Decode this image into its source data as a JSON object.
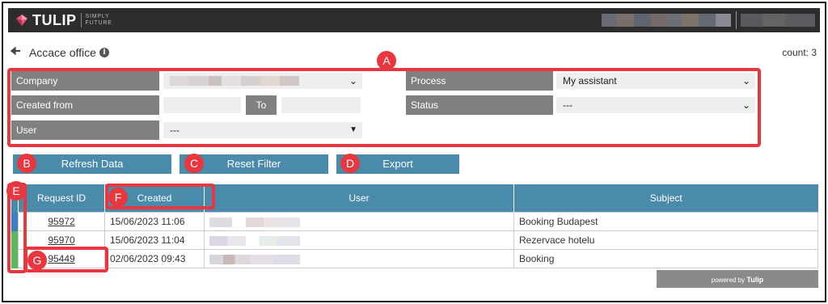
{
  "brand": {
    "name": "TULIP",
    "tagline_1": "SIMPLY",
    "tagline_2": "FUTURE"
  },
  "page": {
    "title": "Accace office",
    "count_text": "count: 3"
  },
  "filters": {
    "company_label": "Company",
    "created_from_label": "Created from",
    "to_label": "To",
    "user_label": "User",
    "user_value": "---",
    "process_label": "Process",
    "process_value": "My assistant",
    "status_label": "Status",
    "status_value": "---"
  },
  "buttons": {
    "refresh": "Refresh Data",
    "reset": "Reset Filter",
    "export": "Export"
  },
  "table": {
    "headers": {
      "request_id": "Request ID",
      "created": "Created",
      "user": "User",
      "subject": "Subject"
    },
    "rows": [
      {
        "id": "95972",
        "created": "15/06/2023 11:06",
        "subject": "Booking Budapest",
        "color": "#3a7fc1"
      },
      {
        "id": "95970",
        "created": "15/06/2023 11:04",
        "subject": "Rezervace hotelu",
        "color": "#5cb85c"
      },
      {
        "id": "95449",
        "created": "02/06/2023 09:43",
        "subject": "Booking",
        "color": "#5cb85c"
      }
    ]
  },
  "powered": {
    "prefix": "powered by",
    "brand": "Tulip"
  },
  "callouts": [
    "A",
    "B",
    "C",
    "D",
    "E",
    "F",
    "G"
  ],
  "colors": {
    "accent": "#4a8aaa",
    "callout": "#e8373f",
    "label_bg": "#808080",
    "topbar": "#2d2d2d"
  }
}
